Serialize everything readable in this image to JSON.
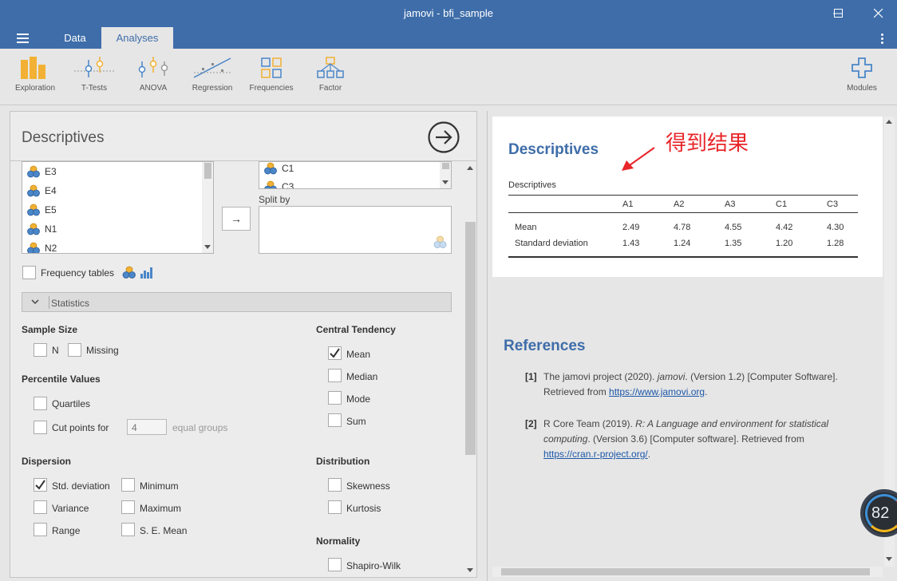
{
  "window": {
    "title": "jamovi - bfi_sample"
  },
  "tabs": [
    {
      "label": "Data",
      "active": false
    },
    {
      "label": "Analyses",
      "active": true
    }
  ],
  "ribbon": {
    "items": [
      {
        "label": "Exploration",
        "icon": "bar-chart-icon"
      },
      {
        "label": "T-Tests",
        "icon": "ttest-icon"
      },
      {
        "label": "ANOVA",
        "icon": "anova-icon"
      },
      {
        "label": "Regression",
        "icon": "regression-icon"
      },
      {
        "label": "Frequencies",
        "icon": "frequencies-icon"
      },
      {
        "label": "Factor",
        "icon": "factor-icon"
      }
    ],
    "modules_label": "Modules"
  },
  "options": {
    "title": "Descriptives",
    "variable_list": [
      "E3",
      "E4",
      "E5",
      "N1",
      "N2"
    ],
    "selected_variables": [
      "C1",
      "C3"
    ],
    "split_by_label": "Split by",
    "frequency_tables_label": "Frequency tables",
    "statistics_label": "Statistics",
    "sample_size": {
      "heading": "Sample Size",
      "n": "N",
      "missing": "Missing"
    },
    "percentile": {
      "heading": "Percentile Values",
      "quartiles": "Quartiles",
      "cut_points": "Cut points for",
      "cut_value": "4",
      "equal_groups": "equal groups"
    },
    "central_tendency": {
      "heading": "Central Tendency",
      "mean": "Mean",
      "median": "Median",
      "mode": "Mode",
      "sum": "Sum"
    },
    "dispersion": {
      "heading": "Dispersion",
      "std": "Std. deviation",
      "minimum": "Minimum",
      "variance": "Variance",
      "maximum": "Maximum",
      "range": "Range",
      "se_mean": "S. E. Mean"
    },
    "distribution": {
      "heading": "Distribution",
      "skewness": "Skewness",
      "kurtosis": "Kurtosis"
    },
    "normality": {
      "heading": "Normality",
      "shapiro": "Shapiro-Wilk"
    }
  },
  "results": {
    "title": "Descriptives",
    "annotation": "得到结果",
    "table_caption": "Descriptives",
    "columns": [
      "A1",
      "A2",
      "A3",
      "C1",
      "C3"
    ],
    "rows": [
      {
        "label": "Mean",
        "values": [
          "2.49",
          "4.78",
          "4.55",
          "4.42",
          "4.30"
        ]
      },
      {
        "label": "Standard deviation",
        "values": [
          "1.43",
          "1.24",
          "1.35",
          "1.20",
          "1.28"
        ]
      }
    ],
    "references_title": "References",
    "ref1": {
      "num": "[1]",
      "pre": "The jamovi project (2020). ",
      "italic": "jamovi",
      "post": ". (Version 1.2) [Computer Software].",
      "line2": "Retrieved from ",
      "link": "https://www.jamovi.org",
      "end": "."
    },
    "ref2": {
      "num": "[2]",
      "pre": "R Core Team (2019). ",
      "italic1": "R: A Language and environment for statistical",
      "italic2": "computing",
      "line2_post": ". (Version 3.6) [Computer software]. Retrieved from",
      "link": "https://cran.r-project.org/",
      "end": "."
    }
  },
  "gauge": {
    "value": "82",
    "unit": "%"
  },
  "colors": {
    "brand": "#3e6da9",
    "annotation": "#e8262a",
    "link": "#1d57a8"
  }
}
